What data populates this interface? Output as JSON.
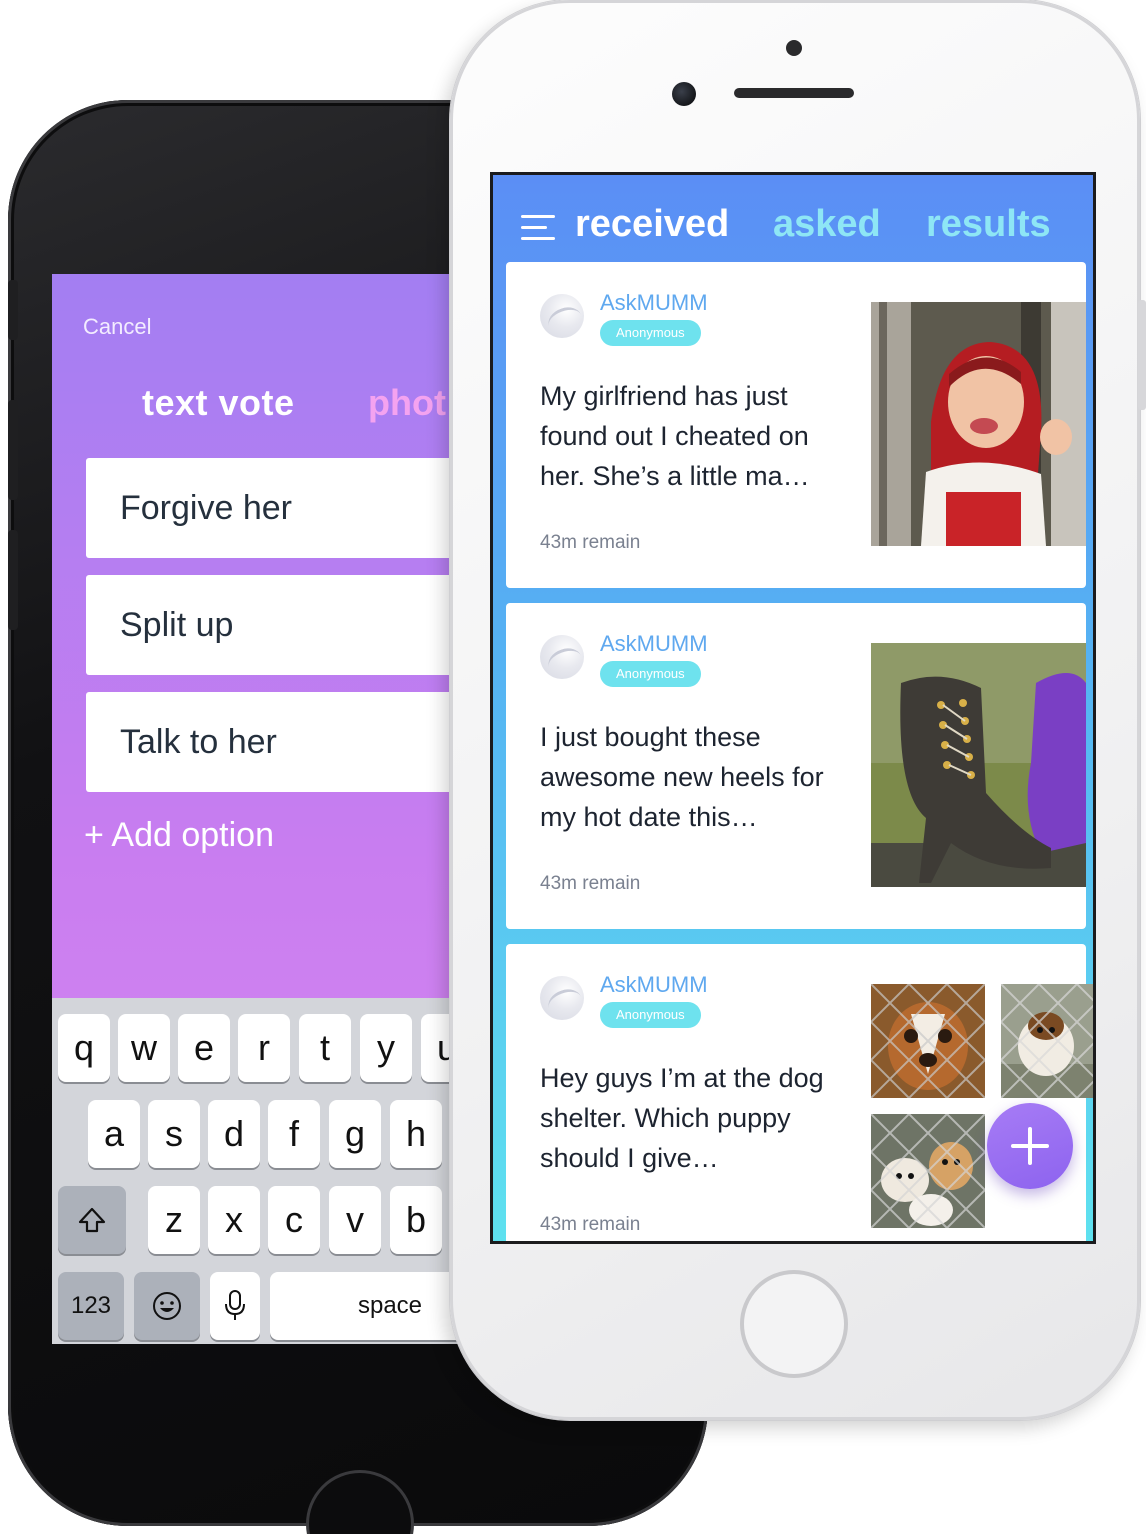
{
  "composer": {
    "cancel_label": "Cancel",
    "tabs": [
      {
        "label": "text vote"
      },
      {
        "label": "phot"
      }
    ],
    "options": [
      {
        "label": "Forgive her"
      },
      {
        "label": "Split up"
      },
      {
        "label": "Talk to her"
      }
    ],
    "add_option_label": "+ Add option",
    "keyboard": {
      "row1": [
        "q",
        "w",
        "e",
        "r",
        "t",
        "y",
        "u"
      ],
      "row2": [
        "a",
        "s",
        "d",
        "f",
        "g",
        "h"
      ],
      "row3": [
        "z",
        "x",
        "c",
        "v",
        "b"
      ],
      "numbers_key": "123",
      "space_key": "space",
      "shift_icon": "shift-icon",
      "emoji_icon": "emoji-icon",
      "mic_icon": "microphone-icon"
    }
  },
  "feed": {
    "tabs": [
      {
        "label": "received",
        "active": true
      },
      {
        "label": "asked",
        "active": false
      },
      {
        "label": "results",
        "active": false
      }
    ],
    "menu_icon": "hamburger-menu-icon",
    "cards": [
      {
        "author": "AskMUMM",
        "badge": "Anonymous",
        "text": "My girlfriend has just found out I cheated on her. She’s a little ma…",
        "remaining": "43m remain",
        "media": "single-photo-red-hood-woman"
      },
      {
        "author": "AskMUMM",
        "badge": "Anonymous",
        "text": "I just bought these awesome new heels for my hot date this…",
        "remaining": "43m remain",
        "media": "single-photo-high-heel-boots"
      },
      {
        "author": "AskMUMM",
        "badge": "Anonymous",
        "text": "Hey guys I’m at the dog shelter. Which puppy should I give…",
        "remaining": "43m remain",
        "media": "photo-grid-shelter-dogs"
      }
    ],
    "fab_icon": "plus-icon",
    "colors": {
      "header_gradient_top": "#5b8ef5",
      "header_gradient_bottom": "#5ee1ef",
      "author_blue": "#5fa8ef",
      "badge_cyan": "#6ee2ee",
      "fab_purple": "#9a6ff2",
      "composer_purple": "#b27ef2"
    }
  }
}
